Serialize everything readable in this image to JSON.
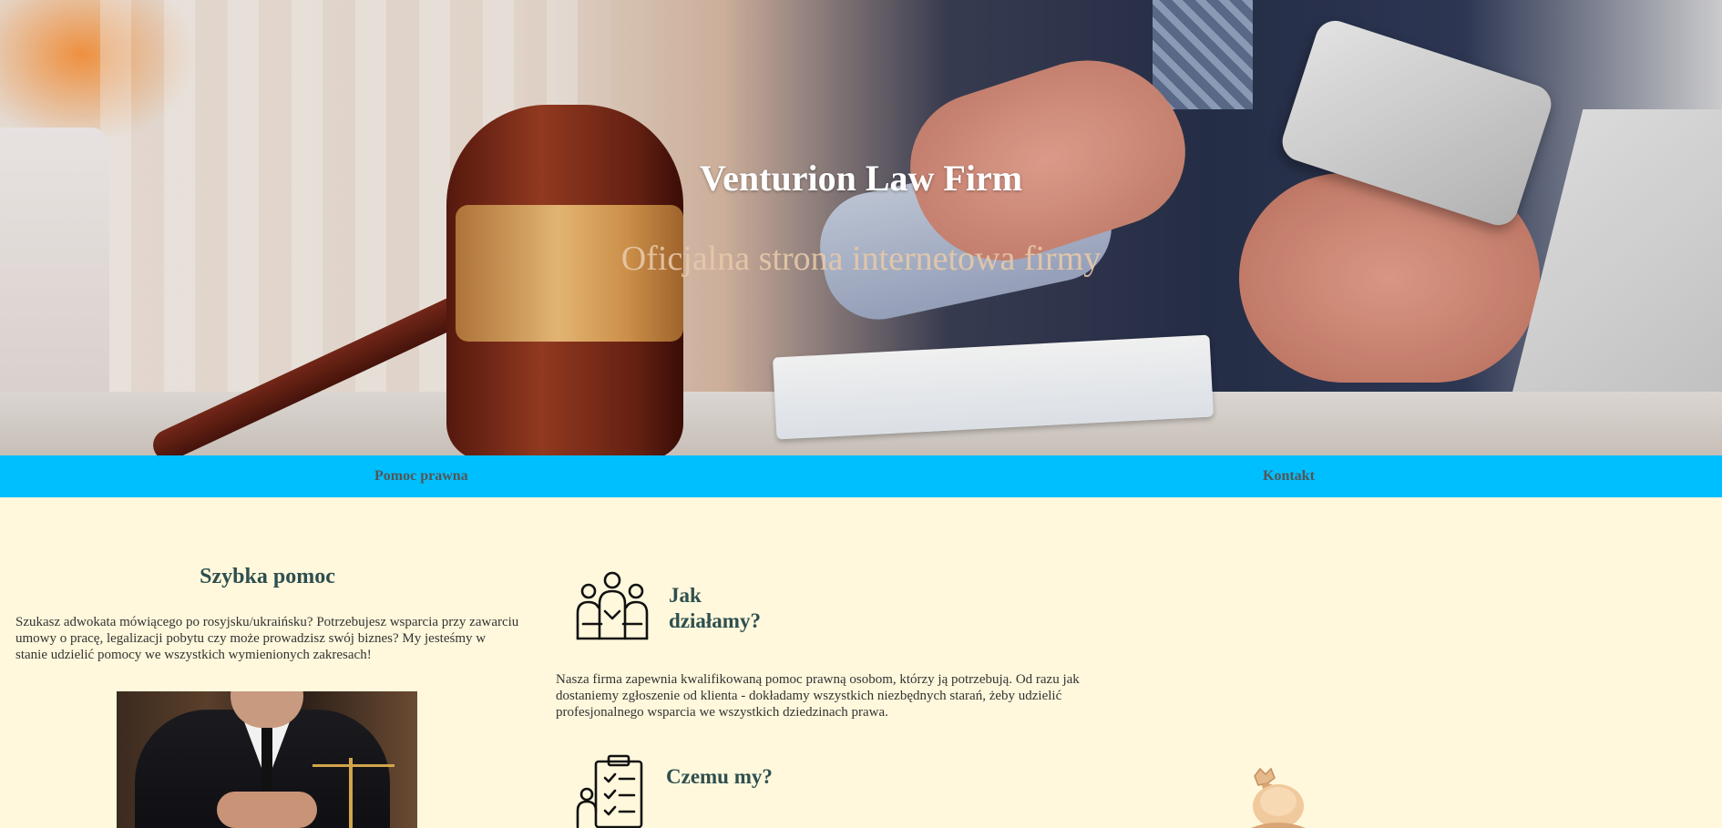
{
  "hero": {
    "title": "Venturion Law Firm",
    "subtitle": "Oficjalna strona internetowa firmy"
  },
  "nav": {
    "items": [
      {
        "label": "Pomoc prawna"
      },
      {
        "label": "Kontakt"
      }
    ],
    "background_color": "#00bfff"
  },
  "sections": {
    "quick_help": {
      "title": "Szybka pomoc",
      "text": "Szukasz adwokata mówiącego po rosyjsku/ukraińsku? Potrzebujesz wsparcia przy zawarciu umowy o pracę, legalizacji pobytu czy może prowadzisz swój biznes? My jesteśmy w stanie udzielić pomocy we wszystkich wymienionych zakresach!"
    },
    "how_we_work": {
      "title": "Jak działamy?",
      "text": "Nasza firma zapewnia kwalifikowaną pomoc prawną osobom, którzy ją potrzebują. Od razu jak dostaniemy zgłoszenie od klienta - dokładamy wszystkich niezbędnych starań, żeby udzielić profesjonalnego wsparcia we wszystkich dziedzinach prawa."
    },
    "why_us": {
      "title": "Czemu my?"
    }
  },
  "icons": {
    "team": "team-icon",
    "checklist": "checklist-icon",
    "chess": "chess-piece-icon"
  },
  "colors": {
    "page_background": "#fff8dc",
    "heading": "#2f4f4f",
    "nav_text": "#555555"
  }
}
